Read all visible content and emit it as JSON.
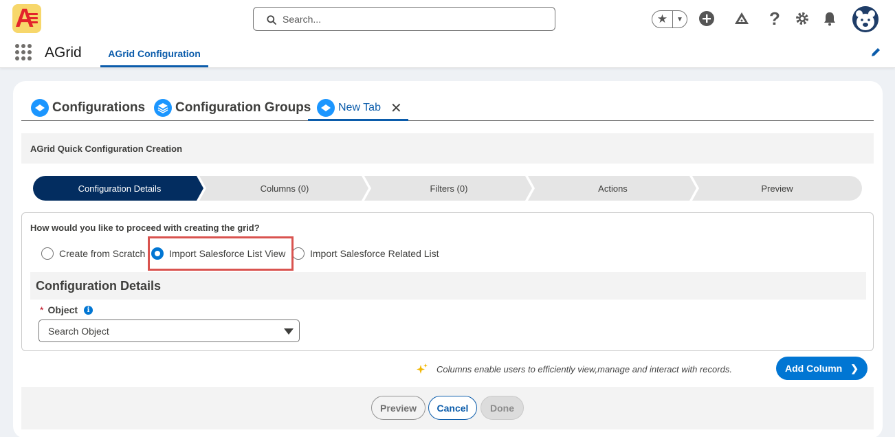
{
  "header": {
    "search_placeholder": "Search...",
    "icons": [
      "star-icon",
      "chevron-down-icon",
      "add-icon",
      "trailhead-icon",
      "help-icon",
      "setup-gear-icon",
      "bell-icon",
      "user-avatar"
    ]
  },
  "nav": {
    "app_name": "AGrid",
    "active_tab": "AGrid Configuration"
  },
  "workspace_tabs": [
    {
      "label": "Configurations"
    },
    {
      "label": "Configuration Groups"
    },
    {
      "label": "New Tab",
      "active": true
    }
  ],
  "page": {
    "section_title": "AGrid Quick Configuration Creation",
    "steps": [
      {
        "label": "Configuration Details",
        "active": true
      },
      {
        "label": "Columns (0)"
      },
      {
        "label": "Filters (0)"
      },
      {
        "label": "Actions"
      },
      {
        "label": "Preview"
      }
    ],
    "question": "How would you like to proceed with creating the grid?",
    "options": [
      {
        "label": "Create from Scratch",
        "checked": false
      },
      {
        "label": "Import Salesforce List View",
        "checked": true
      },
      {
        "label": "Import Salesforce Related List",
        "checked": false
      }
    ],
    "details_header": "Configuration Details",
    "object_field": {
      "required_mark": "*",
      "label": "Object",
      "info_glyph": "i",
      "placeholder": "Search Object"
    },
    "hint": "Columns enable users to efficiently view,manage and interact with records.",
    "add_column_label": "Add Column"
  },
  "footer": {
    "preview_label": "Preview",
    "cancel_label": "Cancel",
    "done_label": "Done"
  },
  "colors": {
    "brand_blue": "#0176d3",
    "active_step": "#032d60",
    "highlight_red": "#d9534f"
  }
}
